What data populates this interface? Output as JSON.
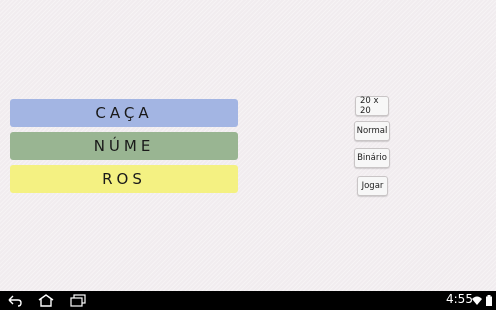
{
  "title_bars": [
    {
      "text": "CAÇA",
      "color": "#a3b5e3"
    },
    {
      "text": "NÚME",
      "color": "#99b592"
    },
    {
      "text": "ROS",
      "color": "#f4f182"
    }
  ],
  "options": {
    "grid_size": "20 x 20",
    "difficulty": "Normal",
    "mode": "Binário",
    "play": "Jogar"
  },
  "status_bar": {
    "time": "4:55"
  },
  "icons": {
    "back": "back-icon",
    "home": "home-icon",
    "recent": "recent-apps-icon",
    "wifi": "wifi-icon",
    "battery": "battery-icon"
  }
}
